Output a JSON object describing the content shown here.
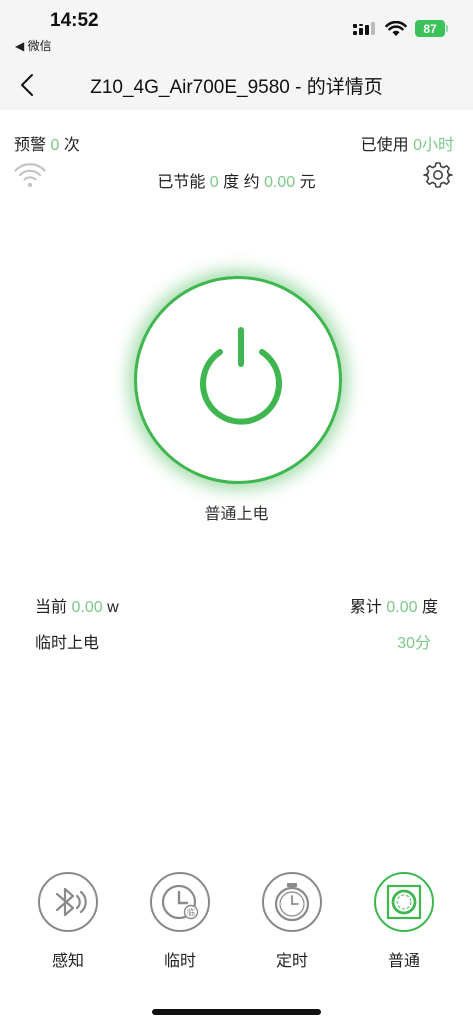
{
  "status_bar": {
    "time": "14:52",
    "back_app": "◀ 微信",
    "battery": "87"
  },
  "nav": {
    "title": "Z10_4G_Air700E_9580 - 的详情页"
  },
  "stats": {
    "warn_prefix": "预警",
    "warn_count": "0",
    "warn_unit": "次",
    "used_prefix": "已使用",
    "used_value": "0小时",
    "saved_prefix": "已节能",
    "saved_value": "0",
    "saved_unit": "度 约",
    "saved_money": "0.00",
    "saved_money_unit": "元"
  },
  "power": {
    "mode_label": "普通上电",
    "color": "#3fb64f"
  },
  "readings": {
    "current_label": "当前",
    "current_value": "0.00",
    "current_unit": "w",
    "total_label": "累计",
    "total_value": "0.00",
    "total_unit": "度",
    "temp_label": "临时上电",
    "temp_value": "30分"
  },
  "tabs": [
    {
      "label": "感知",
      "icon": "bluetooth-sense-icon"
    },
    {
      "label": "临时",
      "icon": "temp-clock-icon"
    },
    {
      "label": "定时",
      "icon": "alarm-clock-icon"
    },
    {
      "label": "普通",
      "icon": "normal-power-icon",
      "active": true
    }
  ]
}
